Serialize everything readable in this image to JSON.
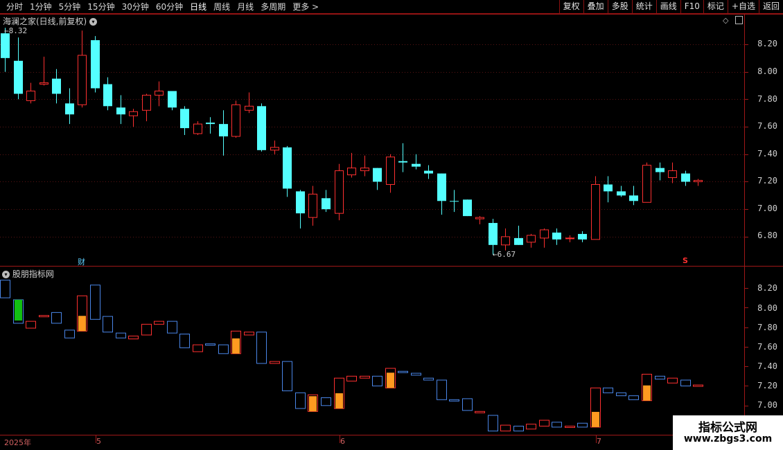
{
  "toolbar": {
    "periods": [
      "分时",
      "1分钟",
      "5分钟",
      "15分钟",
      "30分钟",
      "60分钟",
      "日线",
      "周线",
      "月线",
      "多周期",
      "更多 >"
    ],
    "active_period": "日线",
    "buttons": [
      "复权",
      "叠加",
      "多股",
      "统计",
      "画线",
      "F10",
      "标记",
      "+自选",
      "返回"
    ]
  },
  "main_panel": {
    "title": "海澜之家(日线,前复权)",
    "axis_ticks": [
      "8.20",
      "8.00",
      "7.80",
      "7.60",
      "7.40",
      "7.20",
      "7.00",
      "6.80"
    ],
    "high_label": "8.32",
    "low_label": "6.67",
    "fin_marker": "财",
    "s_marker": "S"
  },
  "sub_panel": {
    "title": "股朋指标网",
    "axis_ticks": [
      "8.20",
      "8.00",
      "7.80",
      "7.60",
      "7.40",
      "7.20",
      "7.00"
    ]
  },
  "dates": {
    "year": "2025年",
    "may": "5",
    "jun": "6",
    "jul": "7"
  },
  "watermark": {
    "line1": "指标公式网",
    "line2": "www.zbgs3.com"
  },
  "colors": {
    "up": "#ff3030",
    "down": "#54ffff",
    "axis_line": "#a01818",
    "sub_down": "#4a86e8",
    "orange": "#ff9a20",
    "green": "#12c012"
  },
  "chart_data": {
    "type": "candlestick",
    "series": [
      {
        "o": 8.1,
        "c": 8.28,
        "h": 8.32,
        "l": 8.0,
        "d": "d"
      },
      {
        "o": 8.08,
        "c": 7.84,
        "h": 8.25,
        "l": 7.8,
        "d": "d"
      },
      {
        "o": 7.79,
        "c": 7.86,
        "h": 7.92,
        "l": 7.77,
        "d": "u"
      },
      {
        "o": 7.91,
        "c": 7.92,
        "h": 8.11,
        "l": 7.9,
        "d": "u"
      },
      {
        "o": 7.95,
        "c": 7.84,
        "h": 8.02,
        "l": 7.77,
        "d": "d"
      },
      {
        "o": 7.77,
        "c": 7.69,
        "h": 7.88,
        "l": 7.62,
        "d": "d"
      },
      {
        "o": 7.76,
        "c": 8.12,
        "h": 8.3,
        "l": 7.74,
        "d": "u"
      },
      {
        "o": 8.23,
        "c": 7.88,
        "h": 8.26,
        "l": 7.85,
        "d": "d"
      },
      {
        "o": 7.91,
        "c": 7.75,
        "h": 7.96,
        "l": 7.72,
        "d": "d"
      },
      {
        "o": 7.74,
        "c": 7.69,
        "h": 7.83,
        "l": 7.62,
        "d": "d"
      },
      {
        "o": 7.68,
        "c": 7.71,
        "h": 7.73,
        "l": 7.6,
        "d": "u"
      },
      {
        "o": 7.72,
        "c": 7.83,
        "h": 7.84,
        "l": 7.64,
        "d": "u"
      },
      {
        "o": 7.83,
        "c": 7.86,
        "h": 7.93,
        "l": 7.75,
        "d": "u"
      },
      {
        "o": 7.86,
        "c": 7.74,
        "h": 7.86,
        "l": 7.72,
        "d": "d"
      },
      {
        "o": 7.73,
        "c": 7.59,
        "h": 7.75,
        "l": 7.54,
        "d": "d"
      },
      {
        "o": 7.55,
        "c": 7.62,
        "h": 7.64,
        "l": 7.54,
        "d": "u"
      },
      {
        "o": 7.63,
        "c": 7.62,
        "h": 7.67,
        "l": 7.55,
        "d": "d"
      },
      {
        "o": 7.62,
        "c": 7.53,
        "h": 7.72,
        "l": 7.39,
        "d": "d"
      },
      {
        "o": 7.53,
        "c": 7.76,
        "h": 7.79,
        "l": 7.52,
        "d": "u"
      },
      {
        "o": 7.72,
        "c": 7.75,
        "h": 7.85,
        "l": 7.7,
        "d": "u"
      },
      {
        "o": 7.75,
        "c": 7.43,
        "h": 7.77,
        "l": 7.42,
        "d": "d"
      },
      {
        "o": 7.43,
        "c": 7.45,
        "h": 7.5,
        "l": 7.4,
        "d": "u"
      },
      {
        "o": 7.45,
        "c": 7.15,
        "h": 7.46,
        "l": 7.09,
        "d": "d"
      },
      {
        "o": 7.13,
        "c": 6.97,
        "h": 7.14,
        "l": 6.86,
        "d": "d"
      },
      {
        "o": 6.94,
        "c": 7.11,
        "h": 7.17,
        "l": 6.88,
        "d": "u"
      },
      {
        "o": 7.08,
        "c": 7.0,
        "h": 7.14,
        "l": 6.98,
        "d": "d"
      },
      {
        "o": 6.97,
        "c": 7.28,
        "h": 7.33,
        "l": 6.92,
        "d": "u"
      },
      {
        "o": 7.25,
        "c": 7.3,
        "h": 7.41,
        "l": 7.23,
        "d": "u"
      },
      {
        "o": 7.3,
        "c": 7.28,
        "h": 7.39,
        "l": 7.24,
        "d": "u"
      },
      {
        "o": 7.3,
        "c": 7.2,
        "h": 7.3,
        "l": 7.14,
        "d": "d"
      },
      {
        "o": 7.18,
        "c": 7.38,
        "h": 7.4,
        "l": 7.12,
        "d": "u"
      },
      {
        "o": 7.35,
        "c": 7.34,
        "h": 7.48,
        "l": 7.27,
        "d": "d"
      },
      {
        "o": 7.33,
        "c": 7.31,
        "h": 7.4,
        "l": 7.29,
        "d": "d"
      },
      {
        "o": 7.28,
        "c": 7.26,
        "h": 7.32,
        "l": 7.22,
        "d": "d"
      },
      {
        "o": 7.26,
        "c": 7.06,
        "h": 7.26,
        "l": 6.96,
        "d": "d"
      },
      {
        "o": 7.06,
        "c": 7.06,
        "h": 7.14,
        "l": 6.98,
        "d": "d"
      },
      {
        "o": 7.07,
        "c": 6.95,
        "h": 7.07,
        "l": 6.95,
        "d": "d"
      },
      {
        "o": 6.94,
        "c": 6.93,
        "h": 6.95,
        "l": 6.89,
        "d": "u"
      },
      {
        "o": 6.9,
        "c": 6.74,
        "h": 6.93,
        "l": 6.67,
        "d": "d"
      },
      {
        "o": 6.74,
        "c": 6.8,
        "h": 6.86,
        "l": 6.7,
        "d": "u"
      },
      {
        "o": 6.79,
        "c": 6.74,
        "h": 6.88,
        "l": 6.74,
        "d": "d"
      },
      {
        "o": 6.76,
        "c": 6.81,
        "h": 6.82,
        "l": 6.72,
        "d": "u"
      },
      {
        "o": 6.79,
        "c": 6.85,
        "h": 6.86,
        "l": 6.72,
        "d": "u"
      },
      {
        "o": 6.83,
        "c": 6.78,
        "h": 6.86,
        "l": 6.74,
        "d": "d"
      },
      {
        "o": 6.79,
        "c": 6.79,
        "h": 6.81,
        "l": 6.76,
        "d": "u"
      },
      {
        "o": 6.82,
        "c": 6.78,
        "h": 6.84,
        "l": 6.76,
        "d": "d"
      },
      {
        "o": 6.78,
        "c": 7.18,
        "h": 7.24,
        "l": 6.78,
        "d": "u"
      },
      {
        "o": 7.18,
        "c": 7.13,
        "h": 7.24,
        "l": 7.05,
        "d": "d"
      },
      {
        "o": 7.13,
        "c": 7.1,
        "h": 7.17,
        "l": 7.09,
        "d": "d"
      },
      {
        "o": 7.1,
        "c": 7.06,
        "h": 7.17,
        "l": 7.03,
        "d": "d"
      },
      {
        "o": 7.05,
        "c": 7.32,
        "h": 7.34,
        "l": 7.05,
        "d": "u"
      },
      {
        "o": 7.3,
        "c": 7.27,
        "h": 7.34,
        "l": 7.21,
        "d": "d"
      },
      {
        "o": 7.23,
        "c": 7.28,
        "h": 7.34,
        "l": 7.19,
        "d": "u"
      },
      {
        "o": 7.26,
        "c": 7.2,
        "h": 7.28,
        "l": 7.17,
        "d": "d"
      },
      {
        "o": 7.21,
        "c": 7.2,
        "h": 7.22,
        "l": 7.17,
        "d": "u"
      }
    ]
  }
}
